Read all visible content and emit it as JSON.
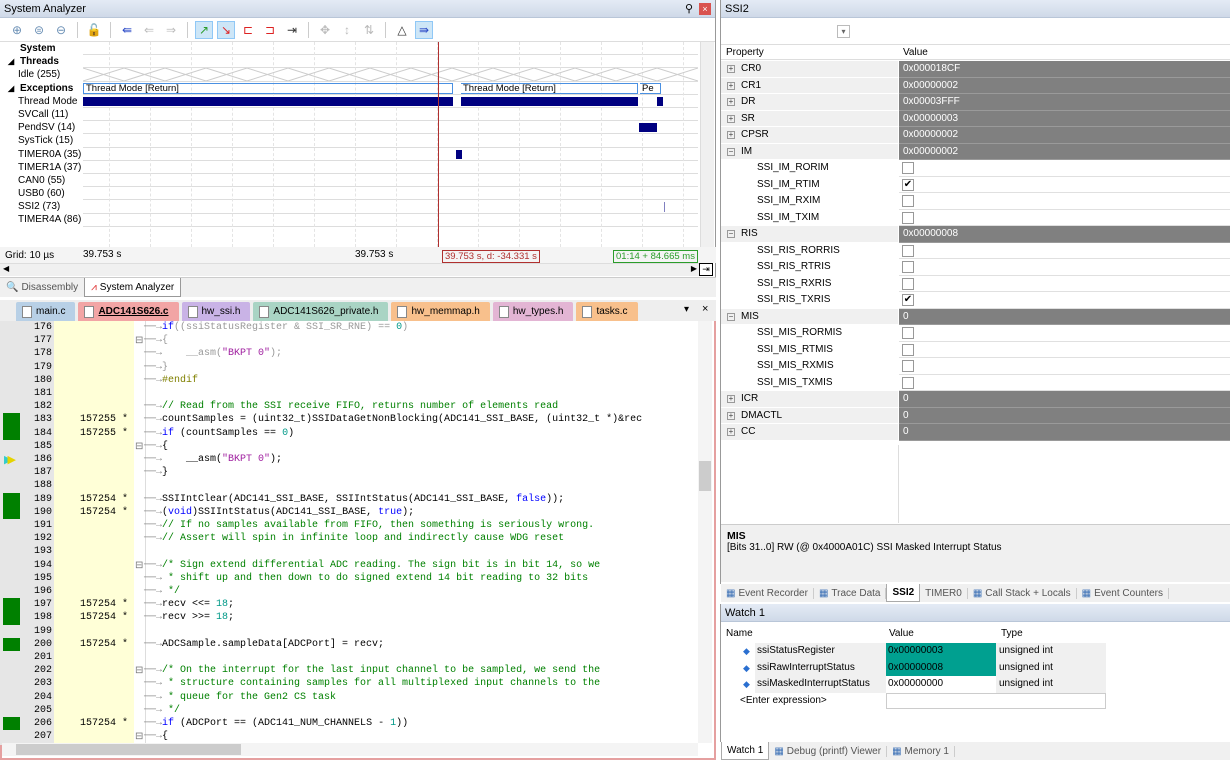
{
  "system_analyzer": {
    "title": "System Analyzer",
    "toolbar": [
      "zoom-in-icon",
      "zoom-fit-icon",
      "zoom-out-icon",
      "lock-icon",
      "jump-to-code-icon",
      "back-icon",
      "forward-icon",
      "rising-edge-icon",
      "falling-edge-icon",
      "prev-transition-icon",
      "next-transition-icon",
      "jump-to-cursor-icon",
      "center-icon",
      "expand-icon",
      "sort-icon",
      "delta-icon",
      "auto-scroll-icon"
    ],
    "rows": [
      {
        "label": "System",
        "bold": true
      },
      {
        "label": "Threads",
        "bold": true,
        "expanded": true
      },
      {
        "label": "Idle (255)"
      },
      {
        "label": "Exceptions",
        "bold": true,
        "expanded": true
      },
      {
        "label": "Thread Mode"
      },
      {
        "label": "SVCall (11)"
      },
      {
        "label": "PendSV (14)"
      },
      {
        "label": "SysTick (15)"
      },
      {
        "label": "TIMER0A (35)"
      },
      {
        "label": "TIMER1A (37)"
      },
      {
        "label": "CAN0 (55)"
      },
      {
        "label": "USB0 (60)"
      },
      {
        "label": "SSI2 (73)"
      },
      {
        "label": "TIMER4A (86)"
      }
    ],
    "state_labels": [
      "Thread Mode [Return]",
      "Thread Mode [Return]",
      "Pe"
    ],
    "grid": "Grid: 10 µs",
    "time_left": "39.753 s",
    "time_mid": "39.753 s",
    "cursor_readout": "39.753 s, d: -34.331 s",
    "time_readout": "01:14 + 84.665 ms",
    "tabs": [
      {
        "label": "Disassembly",
        "active": false
      },
      {
        "label": "System Analyzer",
        "active": true
      }
    ]
  },
  "editor": {
    "tabs": [
      {
        "label": "main.c",
        "color": "#b8d0e6"
      },
      {
        "label": "ADC141S626.c",
        "color": "#f2a5a5",
        "active": true
      },
      {
        "label": "hw_ssi.h",
        "color": "#c9b3e6"
      },
      {
        "label": "ADC141S626_private.h",
        "color": "#a9d4c4"
      },
      {
        "label": "hw_memmap.h",
        "color": "#f8c08c"
      },
      {
        "label": "hw_types.h",
        "color": "#e3b5d4"
      },
      {
        "label": "tasks.c",
        "color": "#f8c08c"
      }
    ],
    "lines": [
      {
        "n": "176",
        "c": "",
        "code": "if((ssiStatusRegister & SSI_SR_RNE) == 0)",
        "gray": true
      },
      {
        "n": "177",
        "c": "",
        "code": "{",
        "gray": true
      },
      {
        "n": "178",
        "c": "",
        "code": "    __asm(\"BKPT 0\");",
        "gray": true
      },
      {
        "n": "179",
        "c": "",
        "code": "}",
        "gray": true
      },
      {
        "n": "180",
        "c": "",
        "code": "#endif",
        "pp": true
      },
      {
        "n": "181",
        "c": "",
        "code": ""
      },
      {
        "n": "182",
        "c": "",
        "code": "// Read from the SSI receive FIFO, returns number of elements read",
        "cm": true
      },
      {
        "n": "183",
        "c": "157255 *",
        "code": "countSamples = (uint32_t)SSIDataGetNonBlocking(ADC141_SSI_BASE, (uint32_t *)&rec"
      },
      {
        "n": "184",
        "c": "157255 *",
        "code": "if (countSamples == 0)"
      },
      {
        "n": "185",
        "c": "",
        "code": "{"
      },
      {
        "n": "186",
        "c": "",
        "code": "    __asm(\"BKPT 0\");"
      },
      {
        "n": "187",
        "c": "",
        "code": "}"
      },
      {
        "n": "188",
        "c": "",
        "code": ""
      },
      {
        "n": "189",
        "c": "157254 *",
        "code": "SSIIntClear(ADC141_SSI_BASE, SSIIntStatus(ADC141_SSI_BASE, false));"
      },
      {
        "n": "190",
        "c": "157254 *",
        "code": "(void)SSIIntStatus(ADC141_SSI_BASE, true);"
      },
      {
        "n": "191",
        "c": "",
        "code": "// If no samples available from FIFO, then something is seriously wrong.",
        "cm": true
      },
      {
        "n": "192",
        "c": "",
        "code": "// Assert will spin in infinite loop and indirectly cause WDG reset",
        "cm": true
      },
      {
        "n": "193",
        "c": "",
        "code": ""
      },
      {
        "n": "194",
        "c": "",
        "code": "/* Sign extend differential ADC reading. The sign bit is in bit 14, so we",
        "cm": true
      },
      {
        "n": "195",
        "c": "",
        "code": " * shift up and then down to do signed extend 14 bit reading to 32 bits",
        "cm": true
      },
      {
        "n": "196",
        "c": "",
        "code": " */",
        "cm": true
      },
      {
        "n": "197",
        "c": "157254 *",
        "code": "recv <<= 18;"
      },
      {
        "n": "198",
        "c": "157254 *",
        "code": "recv >>= 18;"
      },
      {
        "n": "199",
        "c": "",
        "code": ""
      },
      {
        "n": "200",
        "c": "157254 *",
        "code": "ADCSample.sampleData[ADCPort] = recv;"
      },
      {
        "n": "201",
        "c": "",
        "code": ""
      },
      {
        "n": "202",
        "c": "",
        "code": "/* On the interrupt for the last input channel to be sampled, we send the",
        "cm": true
      },
      {
        "n": "203",
        "c": "",
        "code": " * structure containing samples for all multiplexed input channels to the",
        "cm": true
      },
      {
        "n": "204",
        "c": "",
        "code": " * queue for the Gen2 CS task",
        "cm": true
      },
      {
        "n": "205",
        "c": "",
        "code": " */",
        "cm": true
      },
      {
        "n": "206",
        "c": "157254 *",
        "code": "if (ADCPort == (ADC141_NUM_CHANNELS - 1))"
      },
      {
        "n": "207",
        "c": "",
        "code": "{"
      }
    ]
  },
  "ssi2": {
    "title": "SSI2",
    "col_property": "Property",
    "col_value": "Value",
    "rows": [
      {
        "name": "CR0",
        "value": "0x000018CF",
        "type": "reg",
        "exp": "+"
      },
      {
        "name": "CR1",
        "value": "0x00000002",
        "type": "reg",
        "exp": "+"
      },
      {
        "name": "DR",
        "value": "0x00003FFF",
        "type": "reg",
        "exp": "+"
      },
      {
        "name": "SR",
        "value": "0x00000003",
        "type": "reg",
        "exp": "+"
      },
      {
        "name": "CPSR",
        "value": "0x00000002",
        "type": "reg",
        "exp": "+"
      },
      {
        "name": "IM",
        "value": "0x00000002",
        "type": "reg",
        "exp": "-"
      },
      {
        "name": "SSI_IM_RORIM",
        "checked": false,
        "type": "bit"
      },
      {
        "name": "SSI_IM_RTIM",
        "checked": true,
        "type": "bit"
      },
      {
        "name": "SSI_IM_RXIM",
        "checked": false,
        "type": "bit"
      },
      {
        "name": "SSI_IM_TXIM",
        "checked": false,
        "type": "bit"
      },
      {
        "name": "RIS",
        "value": "0x00000008",
        "type": "reg",
        "exp": "-"
      },
      {
        "name": "SSI_RIS_RORRIS",
        "checked": false,
        "type": "bit"
      },
      {
        "name": "SSI_RIS_RTRIS",
        "checked": false,
        "type": "bit"
      },
      {
        "name": "SSI_RIS_RXRIS",
        "checked": false,
        "type": "bit"
      },
      {
        "name": "SSI_RIS_TXRIS",
        "checked": true,
        "type": "bit"
      },
      {
        "name": "MIS",
        "value": "0",
        "type": "reg",
        "exp": "-"
      },
      {
        "name": "SSI_MIS_RORMIS",
        "checked": false,
        "type": "bit"
      },
      {
        "name": "SSI_MIS_RTMIS",
        "checked": false,
        "type": "bit"
      },
      {
        "name": "SSI_MIS_RXMIS",
        "checked": false,
        "type": "bit"
      },
      {
        "name": "SSI_MIS_TXMIS",
        "checked": false,
        "type": "bit"
      },
      {
        "name": "ICR",
        "value": "0",
        "type": "reg",
        "exp": "+"
      },
      {
        "name": "DMACTL",
        "value": "0",
        "type": "reg",
        "exp": "+"
      },
      {
        "name": "CC",
        "value": "0",
        "type": "reg",
        "exp": "+"
      }
    ],
    "info_title": "MIS",
    "info_desc": "[Bits 31..0] RW (@ 0x4000A01C) SSI Masked Interrupt Status",
    "tabs": [
      {
        "label": "Event Recorder"
      },
      {
        "label": "Trace Data"
      },
      {
        "label": "SSI2",
        "active": true
      },
      {
        "label": "TIMER0"
      },
      {
        "label": "Call Stack + Locals"
      },
      {
        "label": "Event Counters"
      }
    ]
  },
  "watch": {
    "title": "Watch 1",
    "cols": [
      "Name",
      "Value",
      "Type"
    ],
    "rows": [
      {
        "name": "ssiStatusRegister",
        "value": "0x00000003",
        "type": "unsigned int",
        "changed": true
      },
      {
        "name": "ssiRawInterruptStatus",
        "value": "0x00000008",
        "type": "unsigned int",
        "changed": true
      },
      {
        "name": "ssiMaskedInterruptStatus",
        "value": "0x00000000",
        "type": "unsigned int",
        "changed": false
      }
    ],
    "enter_expr": "<Enter expression>",
    "tabs": [
      {
        "label": "Watch 1",
        "active": true
      },
      {
        "label": "Debug (printf) Viewer"
      },
      {
        "label": "Memory 1"
      }
    ]
  },
  "colors": {
    "accent": "#000080",
    "changed": "#00a090",
    "coverage": "#008000",
    "cursor": "#b0302f"
  }
}
